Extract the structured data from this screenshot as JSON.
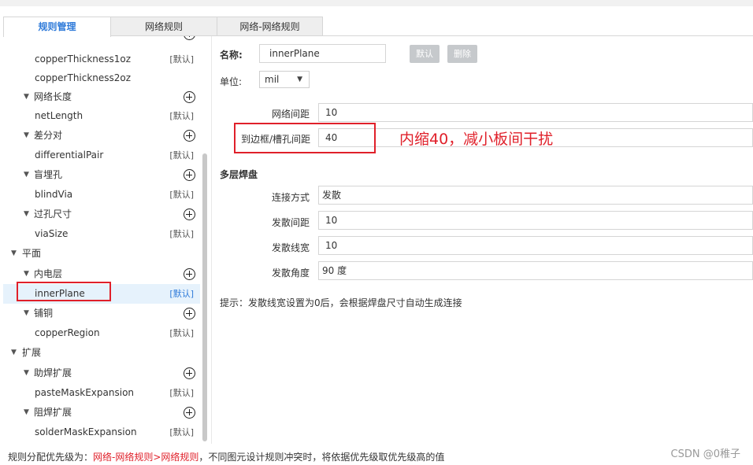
{
  "tabs": [
    {
      "label": "规则管理",
      "active": true
    },
    {
      "label": "网络规则",
      "active": false
    },
    {
      "label": "网络-网络规则",
      "active": false
    }
  ],
  "tree": {
    "default_label": "[默认]",
    "rows": [
      {
        "text": "",
        "level": 1,
        "expanded": false,
        "plus": true,
        "default": false
      },
      {
        "text": "copperThickness1oz",
        "level": 2,
        "default": true
      },
      {
        "text": "copperThickness2oz",
        "level": 2,
        "default": false
      },
      {
        "text": "网络长度",
        "level": 1,
        "expanded": true,
        "plus": true
      },
      {
        "text": "netLength",
        "level": 2,
        "default": true
      },
      {
        "text": "差分对",
        "level": 1,
        "expanded": true,
        "plus": true
      },
      {
        "text": "differentialPair",
        "level": 2,
        "default": true
      },
      {
        "text": "盲埋孔",
        "level": 1,
        "expanded": true,
        "plus": true
      },
      {
        "text": "blindVia",
        "level": 2,
        "default": true
      },
      {
        "text": "过孔尺寸",
        "level": 1,
        "expanded": true,
        "plus": true
      },
      {
        "text": "viaSize",
        "level": 2,
        "default": true
      },
      {
        "text": "平面",
        "level": 0,
        "expanded": true
      },
      {
        "text": "内电层",
        "level": 1,
        "expanded": true,
        "plus": true
      },
      {
        "text": "innerPlane",
        "level": 2,
        "default": true,
        "selected": true
      },
      {
        "text": "铺铜",
        "level": 1,
        "expanded": true,
        "plus": true
      },
      {
        "text": "copperRegion",
        "level": 2,
        "default": true
      },
      {
        "text": "扩展",
        "level": 0,
        "expanded": true
      },
      {
        "text": "助焊扩展",
        "level": 1,
        "expanded": true,
        "plus": true
      },
      {
        "text": "pasteMaskExpansion",
        "level": 2,
        "default": true
      },
      {
        "text": "阻焊扩展",
        "level": 1,
        "expanded": true,
        "plus": true
      },
      {
        "text": "solderMaskExpansion",
        "level": 2,
        "default": true
      }
    ]
  },
  "form": {
    "name_label": "名称:",
    "name_value": "innerPlane",
    "default_button": "默认",
    "delete_button": "删除",
    "unit_label": "单位:",
    "unit_value": "mil",
    "net_gap_label": "网络间距",
    "net_gap_value": "10",
    "edge_gap_label": "到边框/槽孔间距",
    "edge_gap_value": "40",
    "annotation": "内缩40，减小板间干扰",
    "multilayer_title": "多层焊盘",
    "connect_label": "连接方式",
    "connect_value": "发散",
    "spoke_gap_label": "发散间距",
    "spoke_gap_value": "10",
    "spoke_width_label": "发散线宽",
    "spoke_width_value": "10",
    "spoke_angle_label": "发散角度",
    "spoke_angle_value": "90 度",
    "hint": "提示：发散线宽设置为0后，会根据焊盘尺寸自动生成连接"
  },
  "footer": {
    "prefix": "规则分配优先级为：",
    "priority": "网络-网络规则>网络规则",
    "suffix": "，不同图元设计规则冲突时，将依据优先级取优先级高的值"
  },
  "watermark": "CSDN @0稚子",
  "colors": {
    "accent": "#2e7ad9",
    "annotation_red": "#e0202a",
    "button_gray": "#c6c9cc"
  }
}
